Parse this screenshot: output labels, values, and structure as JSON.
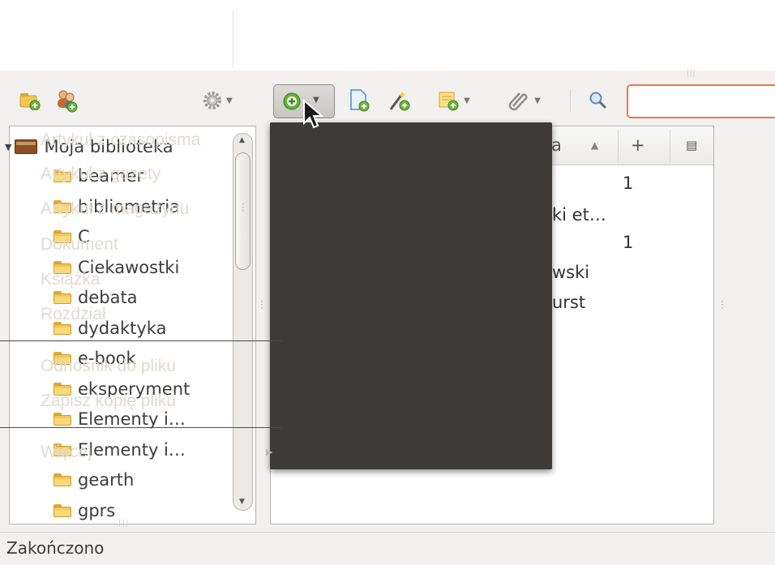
{
  "collections_toolbar": {
    "new_collection_icon": "folder-add-icon",
    "new_group_icon": "group-add-icon",
    "actions_icon": "gear-icon"
  },
  "items_toolbar": {
    "new_item_icon": "plus-circle-icon",
    "add_by_identifier_icon": "document-add-icon",
    "new_note_icon": "wand-add-icon",
    "add_attachment_icon": "note-add-icon",
    "attach_link_icon": "paperclip-icon",
    "search_icon": "magnifier-icon",
    "search_value": ""
  },
  "collections": {
    "library_label": "Moja biblioteka",
    "items": [
      {
        "label": "beamer"
      },
      {
        "label": "bibliometria"
      },
      {
        "label": "C"
      },
      {
        "label": "Ciekawostki"
      },
      {
        "label": "debata"
      },
      {
        "label": "dydaktyka"
      },
      {
        "label": "e-book"
      },
      {
        "label": "eksperyment"
      },
      {
        "label": "Elementy i…"
      },
      {
        "label": "Elementy i…"
      },
      {
        "label": "gearth"
      },
      {
        "label": "gprs"
      }
    ]
  },
  "items_table": {
    "header_partial": "a",
    "sort_indicator": "▲",
    "add_column": "+",
    "column_picker_icon": "column-picker-icon",
    "cells": {
      "r1_count": "1",
      "r2_creator": "ki et…",
      "r3_count": "1",
      "r4_creator": "wski",
      "r5_creator": "urst"
    }
  },
  "new_item_menu": {
    "items": [
      {
        "label": "Artykuł z czasopisma"
      },
      {
        "label": "Artykuł z gazety"
      },
      {
        "label": "Artykuł z magazynu"
      },
      {
        "label": "Dokument"
      },
      {
        "label": "Książka"
      },
      {
        "label": "Rozdział"
      }
    ],
    "file_items": [
      {
        "label": "Odnośnik do pliku"
      },
      {
        "label": "Zapisz kopię pliku"
      }
    ],
    "more_label": "Więcej"
  },
  "status": {
    "text": "Zakończono"
  }
}
